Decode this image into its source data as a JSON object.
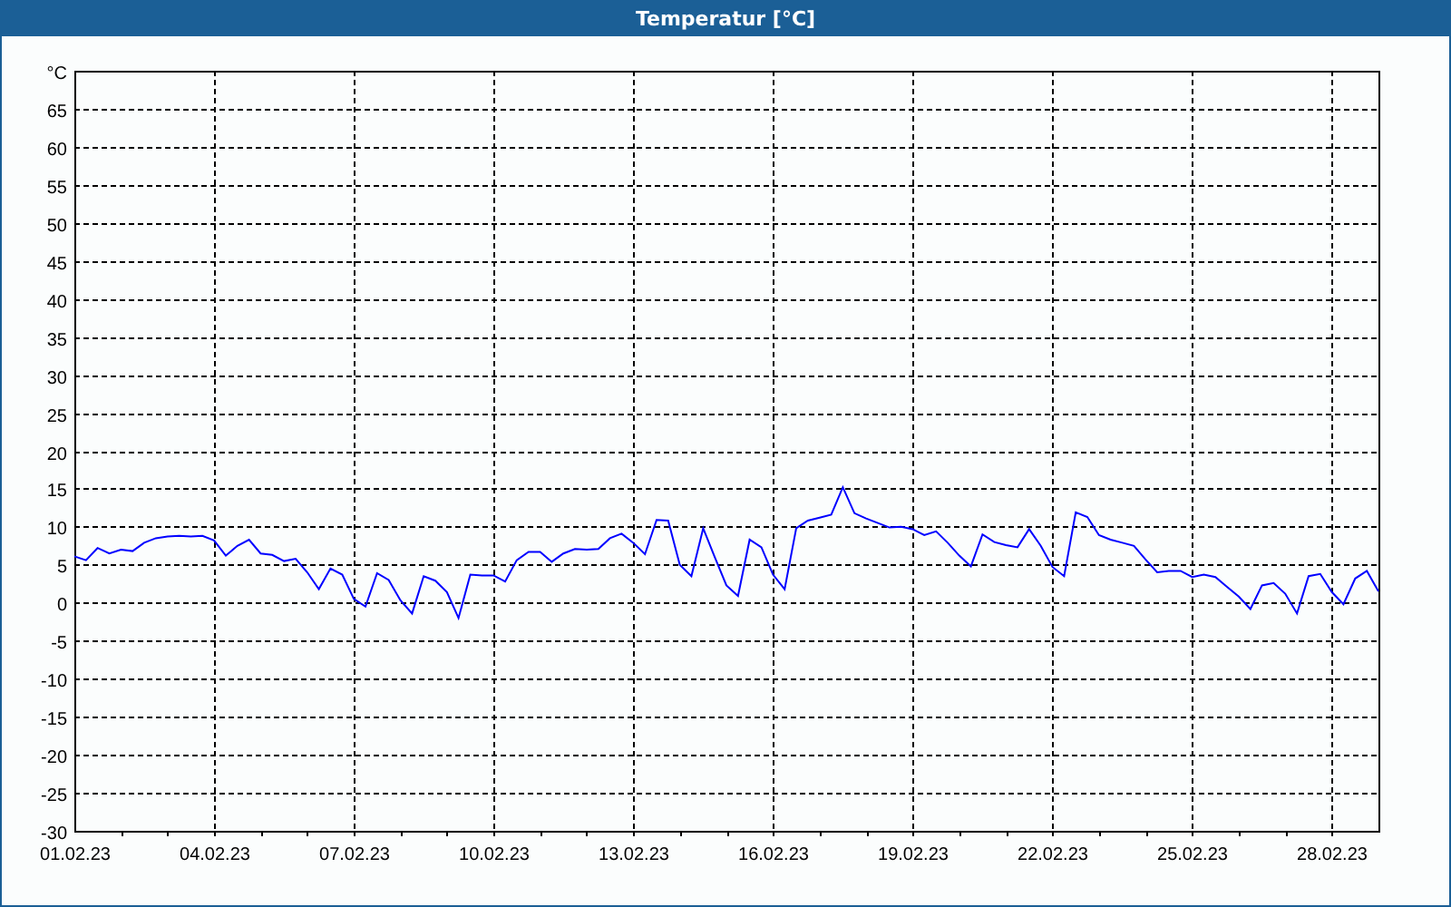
{
  "window": {
    "title": "Temperatur [°C]"
  },
  "chart": {
    "chart_data": {
      "type": "line",
      "grid": true,
      "ylim": [
        -30,
        70
      ],
      "categories": [
        "01.02.23",
        null,
        null,
        null,
        null,
        null,
        null,
        null,
        null,
        null,
        null,
        null,
        "04.02.23",
        null,
        null,
        null,
        null,
        null,
        null,
        null,
        null,
        null,
        null,
        null,
        "07.02.23",
        null,
        null,
        null,
        null,
        null,
        null,
        null,
        null,
        null,
        null,
        null,
        "10.02.23",
        null,
        null,
        null,
        null,
        null,
        null,
        null,
        null,
        null,
        null,
        null,
        "13.02.23",
        null,
        null,
        null,
        null,
        null,
        null,
        null,
        null,
        null,
        null,
        null,
        "16.02.23",
        null,
        null,
        null,
        null,
        null,
        null,
        null,
        null,
        null,
        null,
        null,
        "19.02.23",
        null,
        null,
        null,
        null,
        null,
        null,
        null,
        null,
        null,
        null,
        null,
        "22.02.23",
        null,
        null,
        null,
        null,
        null,
        null,
        null,
        null,
        null,
        null,
        null,
        "25.02.23",
        null,
        null,
        null,
        null,
        null,
        null,
        null,
        null,
        null,
        null,
        null,
        "28.02.23",
        null,
        null,
        null,
        null
      ],
      "yticks": [
        -30,
        -25,
        -20,
        -15,
        -10,
        -5,
        0,
        5,
        10,
        15,
        20,
        25,
        30,
        35,
        40,
        45,
        50,
        55,
        60,
        65,
        {
          "value": 70,
          "label": "°C"
        }
      ],
      "series": [
        {
          "color": "#0000ff",
          "values": [
            6.1,
            5.6,
            7.2,
            6.5,
            7.0,
            6.8,
            7.9,
            8.5,
            8.7,
            8.8,
            8.7,
            8.8,
            8.2,
            6.2,
            7.5,
            8.3,
            6.5,
            6.3,
            5.5,
            5.8,
            4.0,
            1.8,
            4.5,
            3.7,
            0.5,
            -0.5,
            3.9,
            3.0,
            0.3,
            -1.4,
            3.5,
            2.9,
            1.4,
            -2.0,
            3.7,
            3.6,
            3.6,
            2.8,
            5.6,
            6.7,
            6.7,
            5.4,
            6.5,
            7.1,
            7.0,
            7.1,
            8.5,
            9.1,
            7.9,
            6.4,
            10.9,
            10.8,
            5.0,
            3.5,
            9.8,
            6.0,
            2.3,
            0.9,
            8.3,
            7.3,
            3.7,
            1.8,
            9.8,
            10.8,
            11.2,
            11.6,
            15.2,
            11.8,
            11.1,
            10.5,
            9.9,
            10.0,
            9.7,
            8.9,
            9.4,
            7.9,
            6.2,
            4.8,
            9.0,
            8.0,
            7.6,
            7.3,
            9.7,
            7.5,
            4.7,
            3.5,
            11.9,
            11.3,
            8.9,
            8.3,
            7.9,
            7.5,
            5.7,
            4.0,
            4.2,
            4.2,
            3.4,
            3.7,
            3.4,
            2.1,
            0.8,
            -0.8,
            2.3,
            2.6,
            1.2,
            -1.4,
            3.5,
            3.8,
            1.4,
            -0.2,
            3.2,
            4.2,
            1.5
          ]
        }
      ]
    }
  }
}
